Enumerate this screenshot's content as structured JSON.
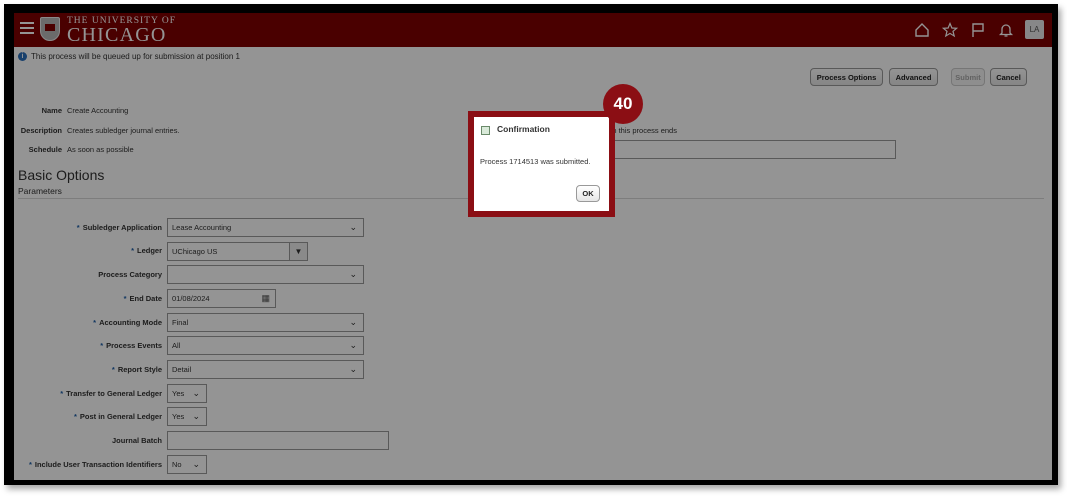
{
  "header": {
    "logo_top": "THE UNIVERSITY OF",
    "logo_main": "CHICAGO",
    "user_initials": "LA",
    "icons": [
      "menu-icon",
      "home-icon",
      "star-icon",
      "flag-icon",
      "bell-icon"
    ],
    "brand_color": "#800000"
  },
  "info_message": "This process will be queued up for submission at position 1",
  "toolbar": {
    "process_options_label": "Process Options",
    "advanced_label": "Advanced",
    "submit_label": "Submit",
    "cancel_label": "Cancel"
  },
  "meta": {
    "name_label": "Name",
    "name_value": "Create Accounting",
    "description_label": "Description",
    "description_value": "Creates subledger journal entries.",
    "schedule_label": "Schedule",
    "schedule_value": "As soon as possible",
    "notify_text": "hen this process ends"
  },
  "basic_options": {
    "title": "Basic Options",
    "subtitle": "Parameters"
  },
  "parameters": {
    "subledger_application": {
      "label": "Subledger Application",
      "value": "Lease Accounting"
    },
    "ledger": {
      "label": "Ledger",
      "value": "UChicago US"
    },
    "process_category": {
      "label": "Process Category",
      "value": ""
    },
    "end_date": {
      "label": "End Date",
      "value": "01/08/2024"
    },
    "accounting_mode": {
      "label": "Accounting Mode",
      "value": "Final"
    },
    "process_events": {
      "label": "Process Events",
      "value": "All"
    },
    "report_style": {
      "label": "Report Style",
      "value": "Detail"
    },
    "transfer_to_gl": {
      "label": "Transfer to General Ledger",
      "value": "Yes"
    },
    "post_in_gl": {
      "label": "Post in General Ledger",
      "value": "Yes"
    },
    "journal_batch": {
      "label": "Journal Batch",
      "value": ""
    },
    "include_user_txn_ids": {
      "label": "Include User Transaction Identifiers",
      "value": "No"
    }
  },
  "dialog": {
    "title": "Confirmation",
    "message": "Process 1714513 was submitted.",
    "ok_label": "OK"
  },
  "step_badge": "40",
  "badge_color": "#8b0e14"
}
